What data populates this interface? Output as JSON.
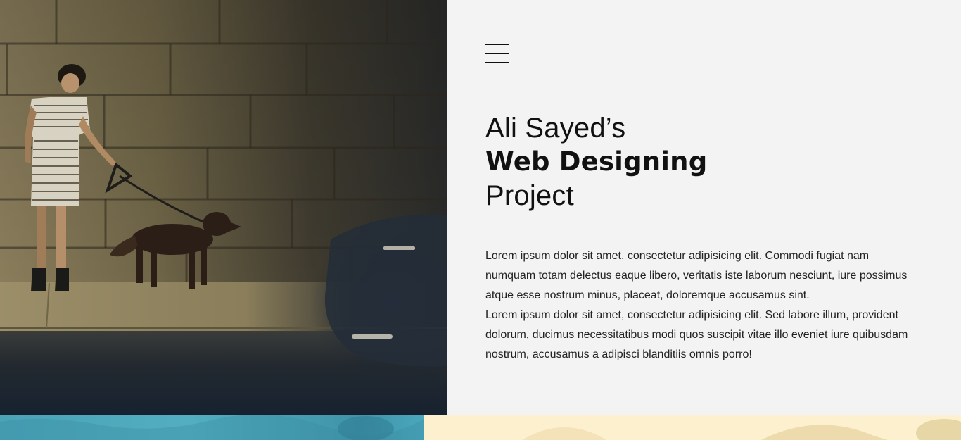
{
  "hero": {
    "title_line1": "Ali Sayed’s",
    "title_line2": "Web Designing",
    "title_line3": "Project",
    "paragraph1": "Lorem ipsum dolor sit amet, consectetur adipisicing elit. Commodi fugiat nam numquam totam delectus eaque libero, veritatis iste laborum nesciunt, iure possimus atque esse nostrum minus, placeat, doloremque accusamus sint.",
    "paragraph2": "Lorem ipsum dolor sit amet, consectetur adipisicing elit. Sed labore illum, provident dolorum, ducimus necessitatibus modi quos suscipit vitae illo eveniet iure quibusdam nostrum, accusamus a adipisci blanditiis omnis porro!"
  },
  "menu": {
    "icon": "hamburger-menu-icon"
  },
  "colors": {
    "panel_background": "#f3f3f3",
    "text": "#111111",
    "photo_shadow": "#1a2532",
    "strip_teal": "#4aa3b7",
    "strip_cream": "#fdf0cf"
  }
}
